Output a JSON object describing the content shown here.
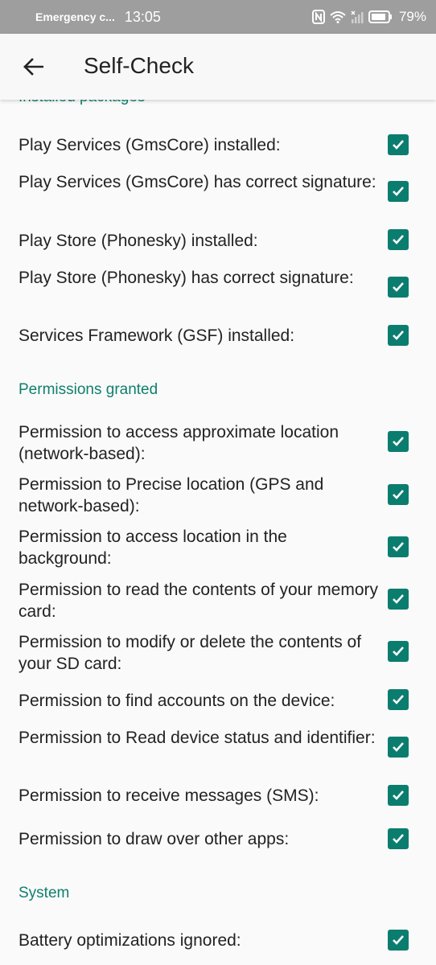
{
  "status_bar": {
    "carrier": "Emergency c...",
    "time": "13:05",
    "battery": "79%"
  },
  "appbar": {
    "title": "Self-Check",
    "back_icon": "arrow-back-icon"
  },
  "colors": {
    "accent": "#0b7d6e",
    "section_text": "#0f7f6e",
    "statusbar": "#9e9e9e"
  },
  "sections": {
    "installed": {
      "title": "Installed packages",
      "items": [
        {
          "label": "Play Services (GmsCore) installed:",
          "checked": true
        },
        {
          "label": "Play Services (GmsCore) has correct signature:",
          "checked": true
        },
        {
          "label": "Play Store (Phonesky) installed:",
          "checked": true
        },
        {
          "label": "Play Store (Phonesky) has correct signature:",
          "checked": true
        },
        {
          "label": "Services Framework (GSF) installed:",
          "checked": true
        }
      ]
    },
    "permissions": {
      "title": "Permissions granted",
      "items": [
        {
          "label": "Permission to access approximate location (network-based):",
          "checked": true
        },
        {
          "label": "Permission to Precise location (GPS and network-based):",
          "checked": true
        },
        {
          "label": "Permission to access location in the background:",
          "checked": true
        },
        {
          "label": "Permission to read the contents of your memory card:",
          "checked": true
        },
        {
          "label": "Permission to modify or delete the contents of your SD card:",
          "checked": true
        },
        {
          "label": "Permission to find accounts on the device:",
          "checked": true
        },
        {
          "label": "Permission to Read device status and identifier:",
          "checked": true
        },
        {
          "label": "Permission to receive messages (SMS):",
          "checked": true
        },
        {
          "label": "Permission to draw over other apps:",
          "checked": true
        }
      ]
    },
    "system": {
      "title": "System",
      "items": [
        {
          "label": "Battery optimizations ignored:",
          "checked": true
        }
      ]
    }
  }
}
